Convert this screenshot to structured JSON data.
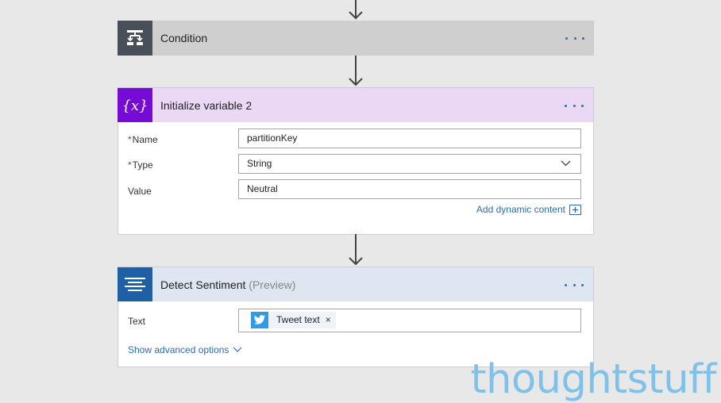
{
  "condition": {
    "title": "Condition"
  },
  "init_variable": {
    "title": "Initialize variable 2",
    "fields": {
      "name": {
        "label": "Name",
        "value": "partitionKey"
      },
      "type": {
        "label": "Type",
        "value": "String"
      },
      "value": {
        "label": "Value",
        "value": "Neutral"
      }
    },
    "dynamic_link": "Add dynamic content"
  },
  "detect_sentiment": {
    "title": "Detect Sentiment",
    "subtitle": "(Preview)",
    "text_label": "Text",
    "token": "Tweet text",
    "token_remove": "×",
    "advanced_link": "Show advanced options"
  },
  "watermark": "thoughtstuff",
  "colors": {
    "condition_icon_bg": "#484f58",
    "condition_header_bg": "#cfcfcf",
    "variable_icon_bg": "#770bd6",
    "variable_header_bg": "#ead8f5",
    "sentiment_icon_bg": "#1f5fa6",
    "sentiment_header_bg": "#dde6f1",
    "accent_link": "#2b6cb8",
    "watermark": "#7ec2ec"
  },
  "icons": {
    "condition": "condition-branch-icon",
    "variable": "variable-braces-icon",
    "sentiment": "text-lines-icon",
    "twitter": "twitter-bird-icon"
  }
}
